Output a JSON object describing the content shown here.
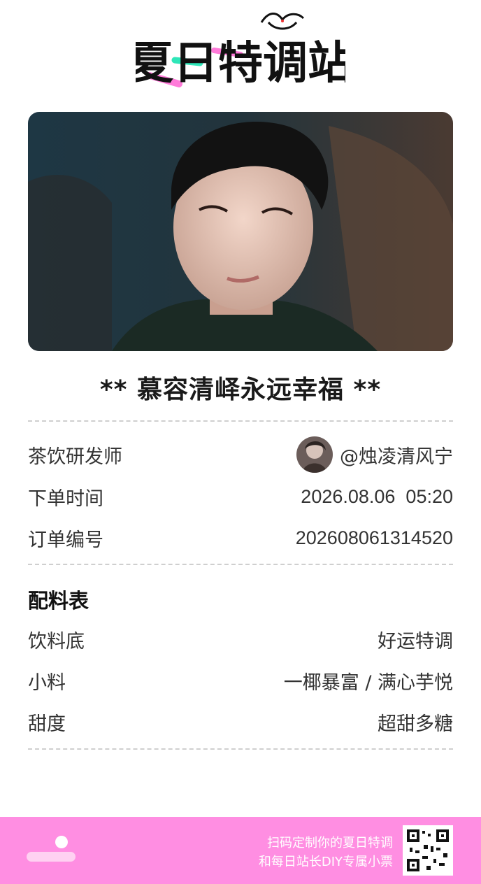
{
  "header": {
    "logo_text": "夏日特调站",
    "logo_alt": "夏日特调站 logo"
  },
  "hero": {
    "image_desc": "portrait photo"
  },
  "ticket": {
    "title": "** 慕容清峄永远幸福 **",
    "rows": [
      {
        "label": "茶饮研发师",
        "value": "@烛凌清风宁"
      },
      {
        "label": "下单时间",
        "value": "2026.08.06  05:20"
      },
      {
        "label": "订单编号",
        "value": "202608061314520"
      }
    ],
    "recipe_title": "配料表",
    "recipe": [
      {
        "label": "饮料底",
        "value": "好运特调"
      },
      {
        "label": "小料",
        "value": "一椰暴富 / 满心芋悦"
      },
      {
        "label": "甜度",
        "value": "超甜多糖"
      }
    ]
  },
  "footer": {
    "line1": "扫码定制你的夏日特调",
    "line2": "和每日站长DIY专属小票",
    "qr_icon": "qr-code-icon",
    "bg_color": "#ff8ee2"
  },
  "colors": {
    "accent_pink": "#ff7ad9",
    "accent_teal": "#2ee6b8",
    "text": "#222222",
    "divider": "#cfcfcf"
  }
}
